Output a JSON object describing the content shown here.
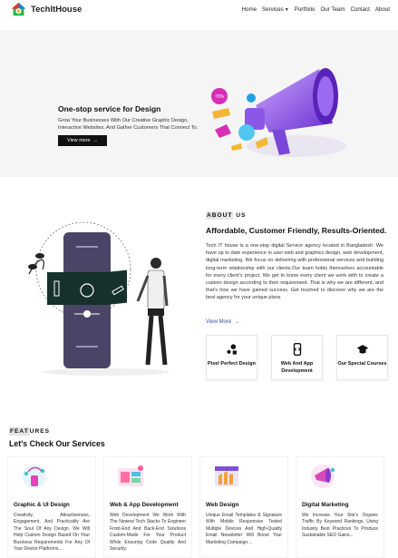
{
  "nav": {
    "brand": "TechItHouse",
    "items": [
      "Home",
      "Services",
      "Portfolio",
      "Our Team",
      "Contact",
      "About"
    ]
  },
  "hero": {
    "title": "One-stop service for Design",
    "text": "Grow Your Businesses With Our Creative Graphic Design, Interactive Websites, And Gather Customers That Connect To.",
    "button": "View more",
    "badge": "70%"
  },
  "about": {
    "kicker_hl": "ABOUT",
    "kicker_rest": " US",
    "title": "Affordable, Customer Friendly, Results-Oriented.",
    "text": "Tech IT house is a one-stop digital Service agency located in Bangladesh. We have up to date experience in user web and graphics design, web development, digital marketing. We focus on delivering with professional services and building long-term relationship with our clients.Our team holds themselves accountable for every client's project. We get to know every client we work with to create a custom design according to their requirement. That is why we are different, and that's how we have gained success. Get touched to discover why we are the best agency for your unique plans",
    "link": "View More",
    "cards": [
      {
        "label": "Pixel Perfect Design"
      },
      {
        "label": "Web And App Development"
      },
      {
        "label": "Our Special Courses"
      }
    ]
  },
  "features": {
    "kicker_hl": "FEAT",
    "kicker_rest": "URES",
    "title": "Let's Check Our Services",
    "items": [
      {
        "title": "Graphic & UI Design",
        "text": "Creativity, Attractiveness, Engagement, And Practicality Are The Soul Of Any Design. We Will Help Custom Design Based On Your Business Requirements For Any Of Your Device Platforms...."
      },
      {
        "title": "Web & App Development",
        "text": "Web Development We Work With The Newest Tech Stacks To Engineer Front-End And Back-End Solutions Custom-Made For Your Product While Ensuring Code Quality And Security."
      },
      {
        "title": "Web Design",
        "text": "Unique Email Templates & Signature With Mobile Responsive Tested Multiple Devices And High-Quality Email Newsletter Will Boost Your Marketing Campaign...."
      },
      {
        "title": "Digital Marketing",
        "text": "We Increase Your Site's Organic Traffic By Keyword Rankings, Using Industry Best Practices To Produce Sustainable SEO Gains..."
      }
    ]
  },
  "colors": {
    "accent": "#7b4fd6",
    "link": "#3a4ea8",
    "dark": "#111111"
  }
}
